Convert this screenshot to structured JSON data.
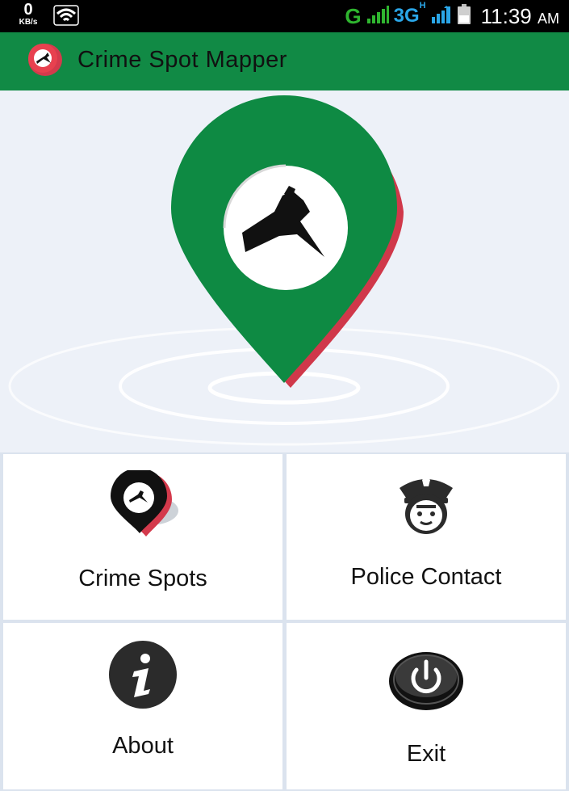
{
  "status_bar": {
    "data_rate": "0",
    "data_rate_unit": "KB/s",
    "network_g": "G",
    "network_3g": "3G",
    "network_h": "H",
    "time": "11:39",
    "ampm": "AM"
  },
  "app_bar": {
    "title": "Crime Spot Mapper",
    "logo_icon": "crime-pin-icon",
    "color": "#118a45"
  },
  "hero": {
    "icon": "crime-location-pin-icon",
    "pin_color": "#0e8a43",
    "shadow_color": "#d0384a"
  },
  "menu": {
    "crime_spots": {
      "label": "Crime Spots",
      "icon": "crime-pin-icon"
    },
    "police_contact": {
      "label": "Police Contact",
      "icon": "police-officer-icon"
    },
    "about": {
      "label": "About",
      "icon": "info-icon"
    },
    "exit": {
      "label": "Exit",
      "icon": "power-icon"
    }
  }
}
